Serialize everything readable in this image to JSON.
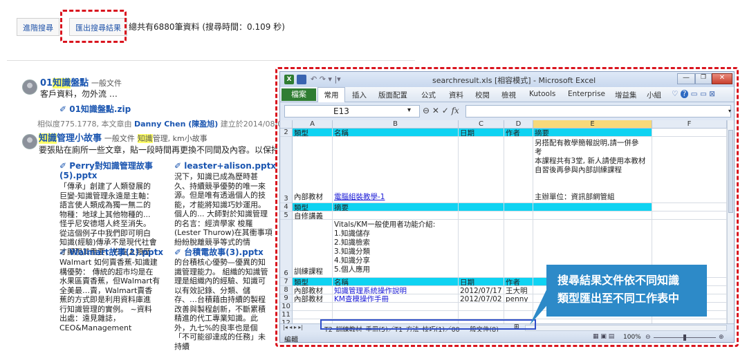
{
  "search_page": {
    "advanced_search_label": "進階搜尋",
    "export_button_label": "匯出搜尋結果",
    "total_text": "總共有6880筆資料 (搜尋時間：0.109 秒)",
    "results": [
      {
        "number": "01",
        "title_hl": "知識",
        "title_rest": "盤點",
        "kind": "一般文件",
        "desc": "客戶資料，勿外流 …",
        "attachment": "01知識盤點.zip",
        "meta_prefix": "相似度775.1778, 本文章由",
        "meta_author": "Danny Chen (陳盈旭)",
        "meta_suffix": "建立於2014/08/0"
      },
      {
        "title_hl": "知識",
        "title_rest": "管理小故事",
        "kind": "一般文件",
        "tag_hl": "知識",
        "tag_rest": "管理, km小故事",
        "desc": "要張貼在廁所一些文章，貼一段時間再更換不同間及內容。以保持新鮮",
        "attachments": [
          {
            "name": "Perry對知識管理故事(5).pptx",
            "snippet": "「傳承」創建了人類發展的\n巨變-知識管理永遠是主軸：\n語言使人類成為獨一無二的\n物種：地球上其他物種的...\n怪乎尼安德塔人終至消失。\n從這個例子中我們即可明白\n知識(經驗)傳承不是現代社會\n才顯現其重要，它在人類歷"
          },
          {
            "name": "leaster+alison.pptx",
            "snippet": "況下，知識已成為歷時甚\n久、持續競爭優勢的唯一來\n源。但是唯有透過個人的技\n能，才能將知識巧妙運用。\n個人的... 大師對於知識管理\n的名言：經濟學家 梭羅\n(Lester Thurow)在其衝事項\n紛紛脫離競爭等式的情"
          },
          {
            "name": "Walmart故事(2).pptx",
            "snippet": "Walmart 如何賣香蕉-知識建\n構優勢： 傳統的超市均是在\n水果區賣香蕉，但Walmart有\n全美最…賣，Walmart賣香\n蕉的方式即是利用資料庫進\n行知識管理的實例。 ~資料\n出處：遠見雜誌，\nCEO&Management"
          },
          {
            "name": "台積電故事(3).pptx",
            "snippet": "的台積核心優勢—優異的知\n識管理能力。 組織的知識管\n理是組織內的經驗、知識可\n以有效記錄、分類、儲\n存、…台積藉由持續的製程\n改善與製程創新，不斷累積\n精進的代工專業知識。此\n外，九七%的良率也是個\n「不可能卻達成的任務」未\n持續"
          }
        ]
      }
    ]
  },
  "excel": {
    "title": "searchresult.xls [相容模式] - Microsoft Excel",
    "ribbon_tabs": [
      "檔案",
      "常用",
      "插入",
      "版面配置",
      "公式",
      "資料",
      "校閱",
      "檢視",
      "Kutools",
      "Enterprise",
      "增益集",
      "小組"
    ],
    "name_box": "E13",
    "columns": [
      "A",
      "B",
      "C",
      "D",
      "E",
      "F"
    ],
    "rows": [
      {
        "n": "2",
        "a": "類型",
        "b": "名稱",
        "c": "日期",
        "d": "作者",
        "e": "摘要",
        "header": true
      },
      {
        "n": "3",
        "a": "內部教材",
        "b": "電腦組裝教學-1",
        "c": "",
        "d": "",
        "e": "另搭配有教學簡報說明,請一併參\n考\n本課程共有3堂, 新人請使用本教材\n自習後再參與內部訓練課程\n\n\n主辦單位：資訊部網管組",
        "link": true
      },
      {
        "n": "4",
        "a": "類型",
        "b": "摘要",
        "c": "",
        "d": "",
        "e": "",
        "header": true
      },
      {
        "n": "5",
        "a": "自修講義",
        "b": "",
        "c": "",
        "d": "",
        "e": ""
      },
      {
        "n": "6",
        "a": "訓練課程",
        "b": "Vitals/KM一般使用者功能介紹:\n1.知識儲存\n2.知識檢索\n3.知識分類\n4.知識分享\n5.個人應用",
        "c": "",
        "d": "",
        "e": ""
      },
      {
        "n": "7",
        "a": "類型",
        "b": "名稱",
        "c": "日期",
        "d": "作者",
        "e": "",
        "header": true
      },
      {
        "n": "8",
        "a": "內部教材",
        "b": "知識管理系統操作說明",
        "c": "2012/07/17",
        "d": "王大明",
        "e": "",
        "link": true
      },
      {
        "n": "9",
        "a": "內部教材",
        "b": "KM查模操作手冊",
        "c": "2012/07/02",
        "d": "penny",
        "e": "",
        "link": true
      },
      {
        "n": "10",
        "a": "",
        "b": "",
        "c": "",
        "d": "",
        "e": ""
      },
      {
        "n": "11",
        "a": "",
        "b": "",
        "c": "",
        "d": "",
        "e": ""
      },
      {
        "n": "12",
        "a": "",
        "b": "",
        "c": "",
        "d": "",
        "e": ""
      }
    ],
    "sheet_tabs_text": "T2_訓練教材_手冊(5)／T1_方法_技巧(1)／00_一般文件(8)",
    "status_left": "編輯",
    "zoom": "100%"
  },
  "callout": {
    "text": "搜尋結果文件依不同知識\n類型匯出至不同工作表中"
  },
  "colors": {
    "highlight_red": "#d9141e",
    "excel_header_cyan": "#0fd3f2",
    "callout_blue": "#2d8ac8"
  }
}
